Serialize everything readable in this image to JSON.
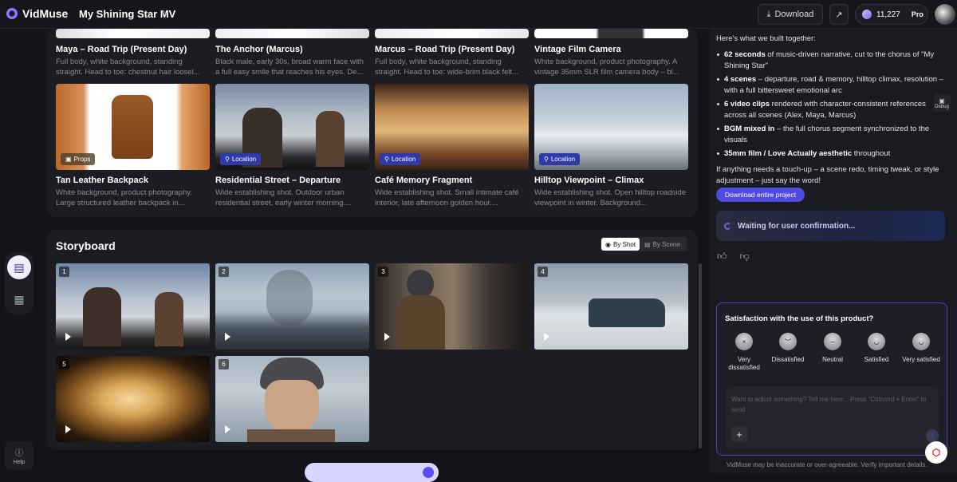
{
  "app": {
    "name": "VidMuse",
    "project_title": "My Shining Star MV"
  },
  "header": {
    "download_label": "Download",
    "credits": "11,227",
    "plan": "Pro"
  },
  "rail": {
    "help_label": "Help"
  },
  "assets_row1": [
    {
      "title": "Maya – Road Trip (Present Day)",
      "desc": "Full body, white background, standing straight. Head to toe: chestnut hair loosel..."
    },
    {
      "title": "The Anchor (Marcus)",
      "desc": "Black male, early 30s, broad warm face with a full easy smile that reaches his eyes. De..."
    },
    {
      "title": "Marcus – Road Trip (Present Day)",
      "desc": "Full body, white background, standing straight. Head to toe: wide-brim black felt..."
    },
    {
      "title": "Vintage Film Camera",
      "desc": "White background, product photography. A vintage 35mm SLR film camera body – bl..."
    }
  ],
  "assets_row2": [
    {
      "title": "Tan Leather Backpack",
      "tag": "Props",
      "desc": "White background, product photography. Large structured leather backpack in..."
    },
    {
      "title": "Residential Street – Departure",
      "tag": "Location",
      "desc": "Wide establishing shot. Outdoor urban residential street, early winter morning...."
    },
    {
      "title": "Café Memory Fragment",
      "tag": "Location",
      "desc": "Wide establishing shot. Small intimate café interior, late afternoon golden hour...."
    },
    {
      "title": "Hilltop Viewpoint – Climax",
      "tag": "Location",
      "desc": "Wide establishing shot. Open hilltop roadside viewpoint in winter. Background..."
    }
  ],
  "storyboard": {
    "title": "Storyboard",
    "by_shot": "By Shot",
    "by_scene": "By Scene",
    "shots": [
      "1",
      "2",
      "3",
      "4",
      "5",
      "6"
    ]
  },
  "chat": {
    "intro": "Here's what we built together:",
    "bullets": [
      {
        "bold": "62 seconds",
        "text": " of music-driven narrative, cut to the chorus of \"My Shining Star\""
      },
      {
        "bold": "4 scenes",
        "text": " – departure, road & memory, hilltop climax, resolution – with a full bittersweet emotional arc"
      },
      {
        "bold": "6 video clips",
        "text": " rendered with character-consistent references across all scenes (Alex, Maya, Marcus)"
      },
      {
        "bold": "BGM mixed in",
        "text": " – the full chorus segment synchronized to the visuals"
      },
      {
        "bold": "35mm film / Love Actually aesthetic",
        "text": " throughout"
      }
    ],
    "closing": "If anything needs a touch-up – a scene redo, timing tweak, or style adjustment – just say the word!",
    "download_project": "Download entire project",
    "waiting": "Waiting for user confirmation...",
    "debug_label": "Debug"
  },
  "survey": {
    "title": "Satisfaction with the use of this product?",
    "ratings": [
      "Very dissatisfied",
      "Dissatisfied",
      "Neutral",
      "Satisfied",
      "Very satisfied"
    ]
  },
  "composer": {
    "placeholder": "Want to adjust something? Tell me here... Press \"Ctrl/cmd + Enter\" to send"
  },
  "footer": {
    "disclaimer": "VidMuse may be inaccurate or over-agreeable. Verify important details."
  },
  "colors": {
    "accent": "#4f4ae0",
    "location_tag": "#2d3aa8",
    "background": "#131419",
    "panel": "#1c1d23"
  }
}
